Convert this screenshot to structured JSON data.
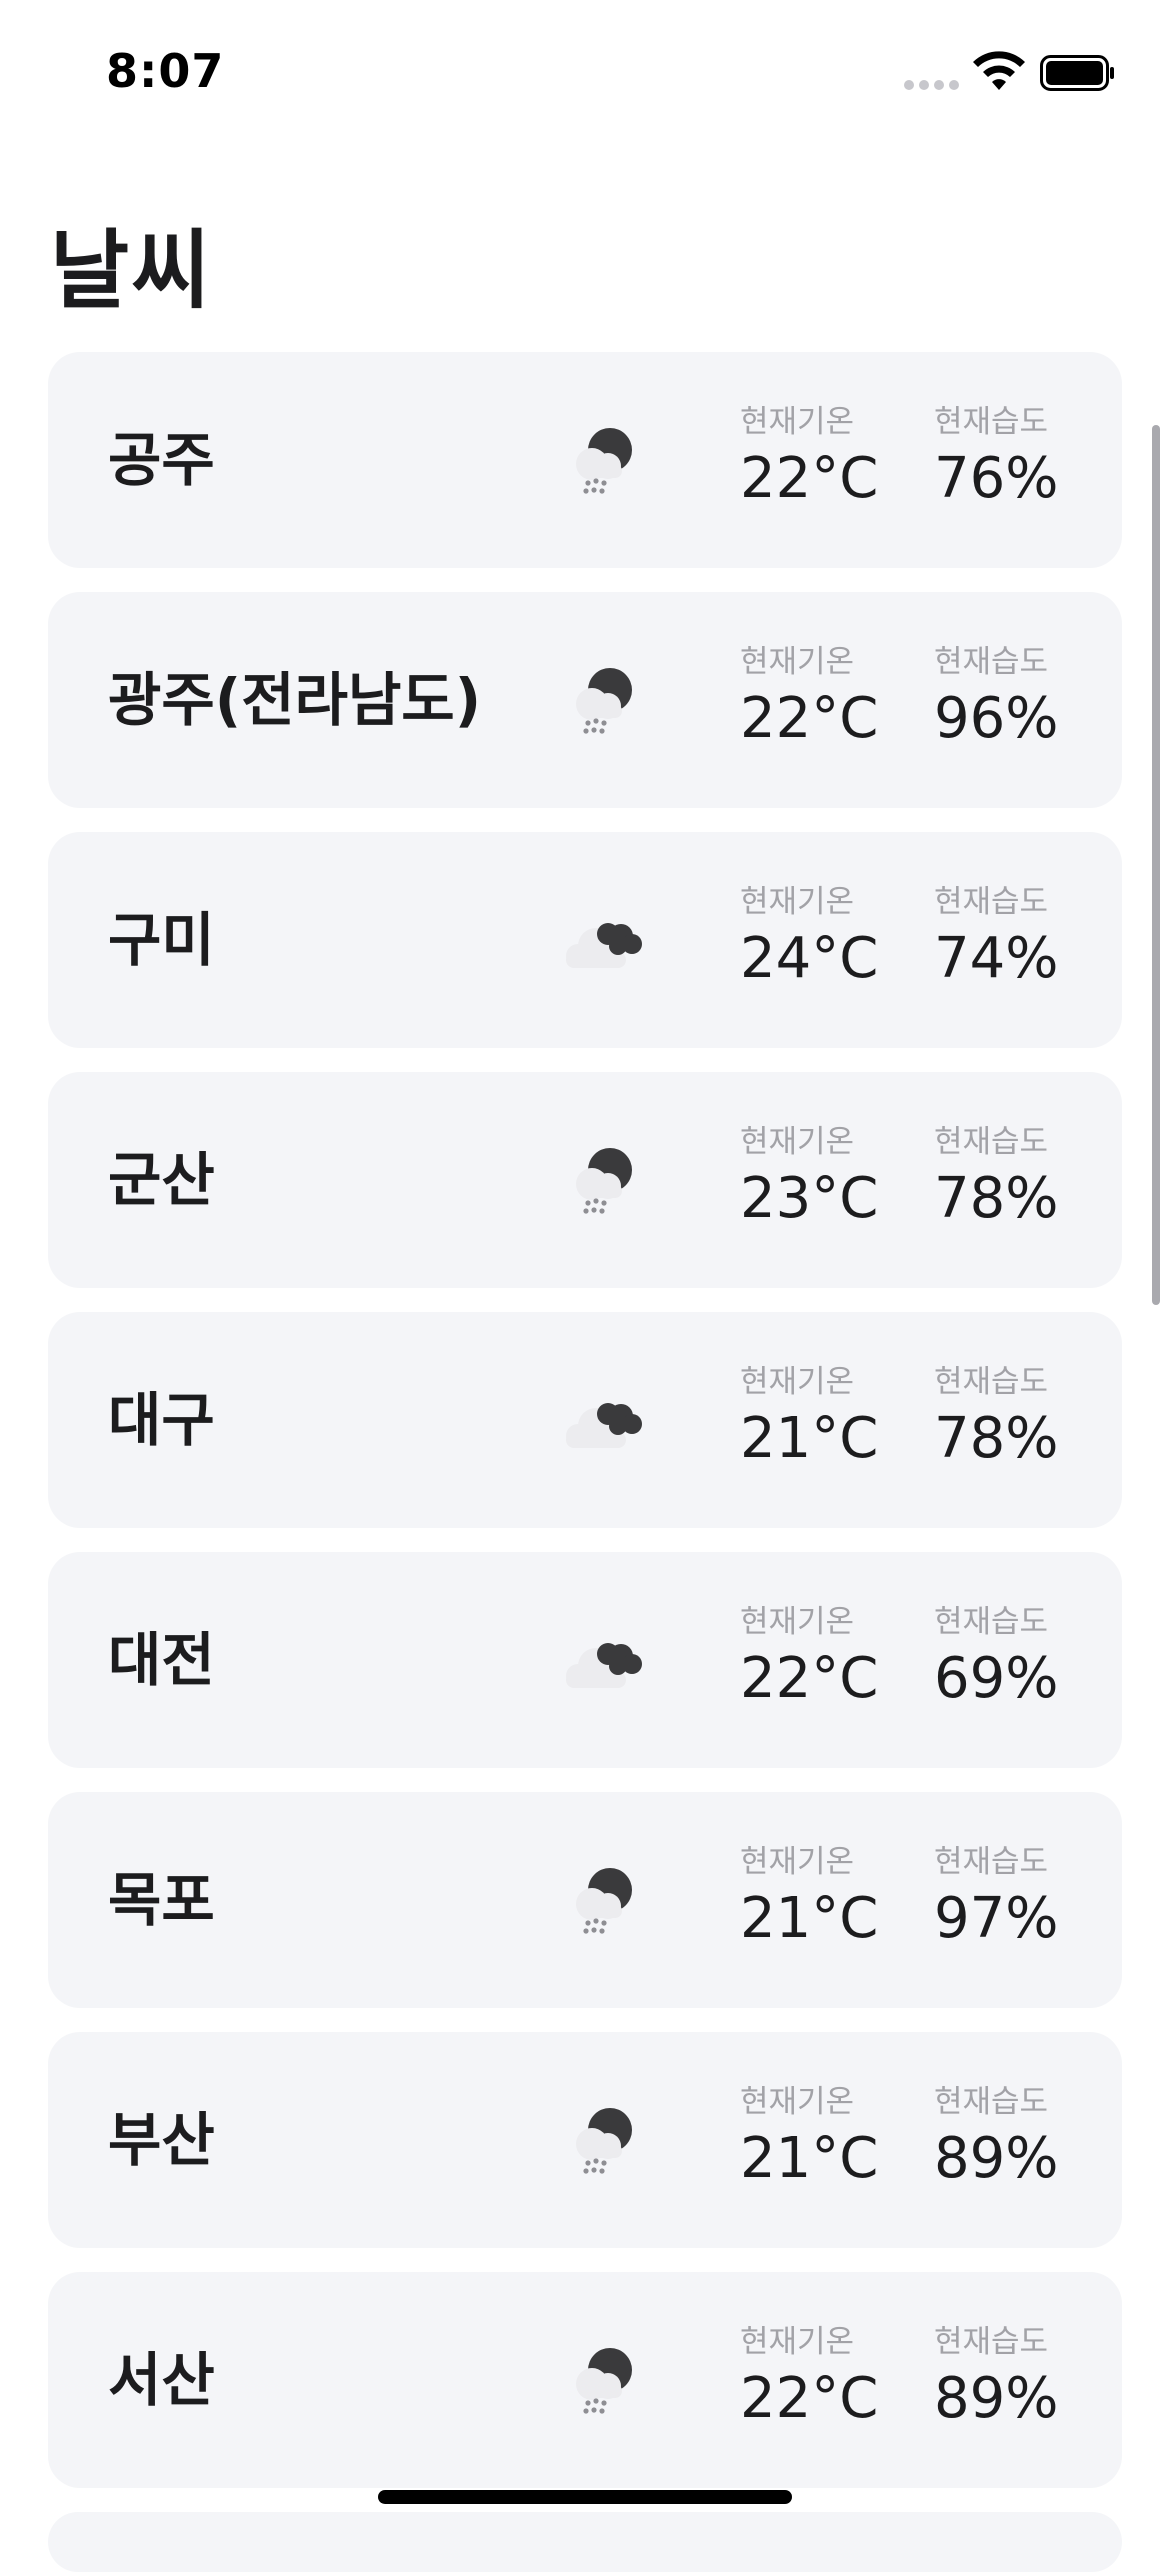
{
  "status_bar": {
    "time": "8:07"
  },
  "page": {
    "title": "날씨"
  },
  "labels": {
    "temperature": "현재기온",
    "humidity": "현재습도"
  },
  "cities": [
    {
      "name": "공주",
      "icon": "rain-cloud-icon",
      "temperature": "22°C",
      "humidity": "76%"
    },
    {
      "name": "광주(전라남도)",
      "icon": "rain-cloud-icon",
      "temperature": "22°C",
      "humidity": "96%"
    },
    {
      "name": "구미",
      "icon": "cloudy-icon",
      "temperature": "24°C",
      "humidity": "74%"
    },
    {
      "name": "군산",
      "icon": "rain-cloud-icon",
      "temperature": "23°C",
      "humidity": "78%"
    },
    {
      "name": "대구",
      "icon": "cloudy-icon",
      "temperature": "21°C",
      "humidity": "78%"
    },
    {
      "name": "대전",
      "icon": "cloudy-icon",
      "temperature": "22°C",
      "humidity": "69%"
    },
    {
      "name": "목포",
      "icon": "rain-cloud-icon",
      "temperature": "21°C",
      "humidity": "97%"
    },
    {
      "name": "부산",
      "icon": "rain-cloud-icon",
      "temperature": "21°C",
      "humidity": "89%"
    },
    {
      "name": "서산",
      "icon": "rain-cloud-icon",
      "temperature": "22°C",
      "humidity": "89%"
    }
  ],
  "colors": {
    "card_background": "#f4f5f8",
    "label_gray": "#a2a2a7",
    "text_dark": "#1c1c1e"
  }
}
